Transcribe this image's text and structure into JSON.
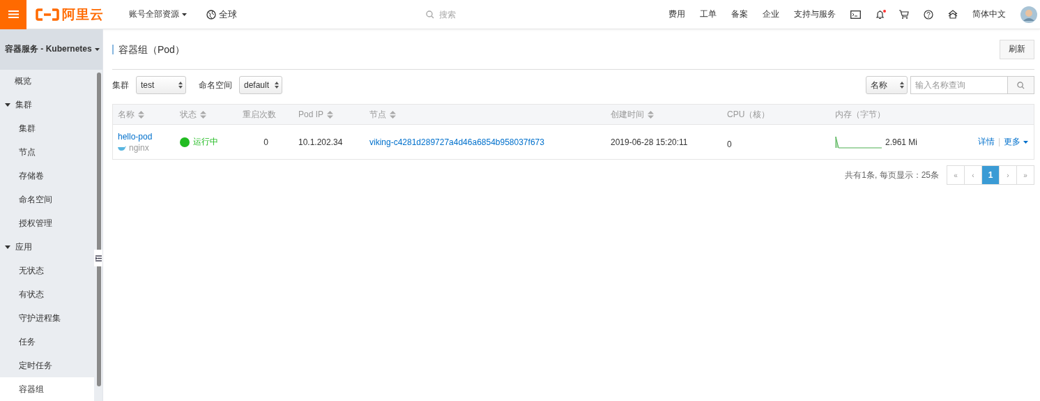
{
  "topbar": {
    "logo_text": "阿里云",
    "account_menu": "账号全部资源",
    "region": "全球",
    "search": {
      "placeholder": "搜索"
    },
    "links": [
      "费用",
      "工单",
      "备案",
      "企业",
      "支持与服务"
    ],
    "bell_unread": true,
    "language": "简体中文"
  },
  "sidebar": {
    "title": "容器服务 - Kubernetes",
    "items": [
      {
        "label": "概览",
        "selected": false
      },
      {
        "label": "集群",
        "selected": false,
        "expanded": true,
        "children": [
          {
            "label": "集群",
            "selected": false
          },
          {
            "label": "节点",
            "selected": false
          },
          {
            "label": "存储卷",
            "selected": false
          },
          {
            "label": "命名空间",
            "selected": false
          },
          {
            "label": "授权管理",
            "selected": false
          }
        ]
      },
      {
        "label": "应用",
        "selected": false,
        "expanded": true,
        "children": [
          {
            "label": "无状态",
            "selected": false
          },
          {
            "label": "有状态",
            "selected": false
          },
          {
            "label": "守护进程集",
            "selected": false
          },
          {
            "label": "任务",
            "selected": false
          },
          {
            "label": "定时任务",
            "selected": false
          },
          {
            "label": "容器组",
            "selected": true
          }
        ]
      }
    ]
  },
  "page": {
    "title": "容器组（Pod）",
    "refresh_button": "刷新",
    "filters": [
      {
        "label": "集群",
        "value": "test"
      },
      {
        "label": "命名空间",
        "value": "default"
      }
    ],
    "search": {
      "field": "名称",
      "placeholder": "输入名称查询"
    },
    "table": {
      "columns": [
        {
          "label": "名称",
          "sortable": true
        },
        {
          "label": "状态",
          "sortable": true
        },
        {
          "label": "重启次数",
          "sortable": false
        },
        {
          "label": "Pod IP",
          "sortable": true
        },
        {
          "label": "节点",
          "sortable": true
        },
        {
          "label": "创建时间",
          "sortable": true
        },
        {
          "label": "CPU（核）",
          "sortable": false
        },
        {
          "label": "内存（字节）",
          "sortable": false
        }
      ],
      "rows": [
        {
          "name": "hello-pod",
          "image": "nginx",
          "status": {
            "kind": "running",
            "text": "运行中"
          },
          "restarts": "0",
          "pod_ip": "10.1.202.34",
          "node": "viking-c4281d289727a4d46a6854b958037f673",
          "created": "2019-06-28 15:20:11",
          "cpu": "0",
          "memory": "2.961 Mi",
          "actions": [
            "详情",
            "更多"
          ]
        }
      ]
    },
    "pagination": {
      "summary": "共有1条, 每页显示：25条",
      "first": "«",
      "prev": "‹",
      "pages": [
        {
          "label": "1",
          "selected": true
        }
      ],
      "next": "›",
      "last": "»"
    }
  }
}
